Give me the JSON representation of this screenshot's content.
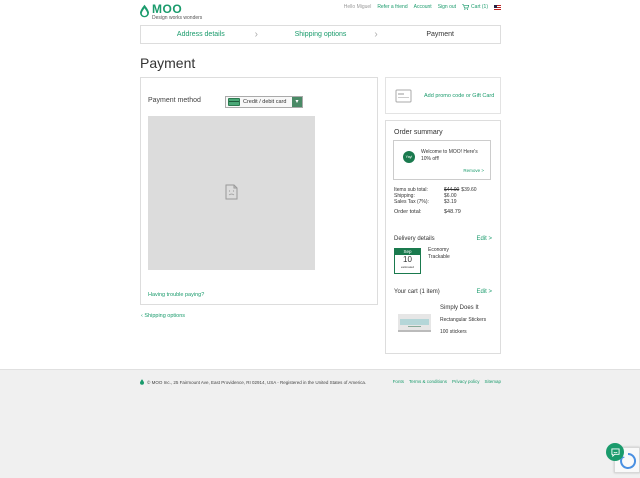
{
  "header": {
    "brand": "MOO",
    "tagline": "Design works wonders",
    "greeting": "Hello Miguel",
    "links": [
      "Refer a friend",
      "Account",
      "Sign out"
    ],
    "cart_label": "Cart (1)"
  },
  "steps": [
    {
      "label": "Address details",
      "state": "done"
    },
    {
      "label": "Shipping options",
      "state": "done"
    },
    {
      "label": "Payment",
      "state": "current"
    }
  ],
  "page_title": "Payment",
  "payment": {
    "method_label": "Payment method",
    "method_value": "Credit / debit card",
    "trouble_link": "Having trouble paying?",
    "back_link": "Shipping options"
  },
  "promo": {
    "label": "Add promo code or Gift Card"
  },
  "summary": {
    "title": "Order summary",
    "welcome": {
      "badge": "Yay!",
      "message": "Welcome to MOO! Here's 10% off!",
      "remove": "Remove >"
    },
    "items_label": "Items sub total:",
    "items_old": "$44.00",
    "items_new": "$39.60",
    "shipping_label": "Shipping:",
    "shipping_value": "$6.00",
    "tax_label": "Sales Tax (7%):",
    "tax_value": "$3.19",
    "total_label": "Order total:",
    "total_value": "$48.79",
    "delivery_title": "Delivery details",
    "delivery_edit": "Edit >",
    "delivery_month": "Sep",
    "delivery_day": "10",
    "delivery_est": "estimated",
    "delivery_line1": "Economy",
    "delivery_line2": "Trackable",
    "cart_title": "Your cart (1 item)",
    "cart_edit": "Edit >",
    "product_name": "Simply Does It",
    "product_type": "Rectangular Stickers",
    "product_qty": "100 stickers"
  },
  "footer": {
    "address": "© MOO Inc., 25 Fairmount Ave, East Providence, RI 02914, USA - Registered in the United States of America.",
    "links": [
      "Fonts",
      "Terms & conditions",
      "Privacy policy",
      "Sitemap"
    ]
  },
  "colors": {
    "accent": "#1a9b6c",
    "dark_green": "#1a7a4e"
  }
}
